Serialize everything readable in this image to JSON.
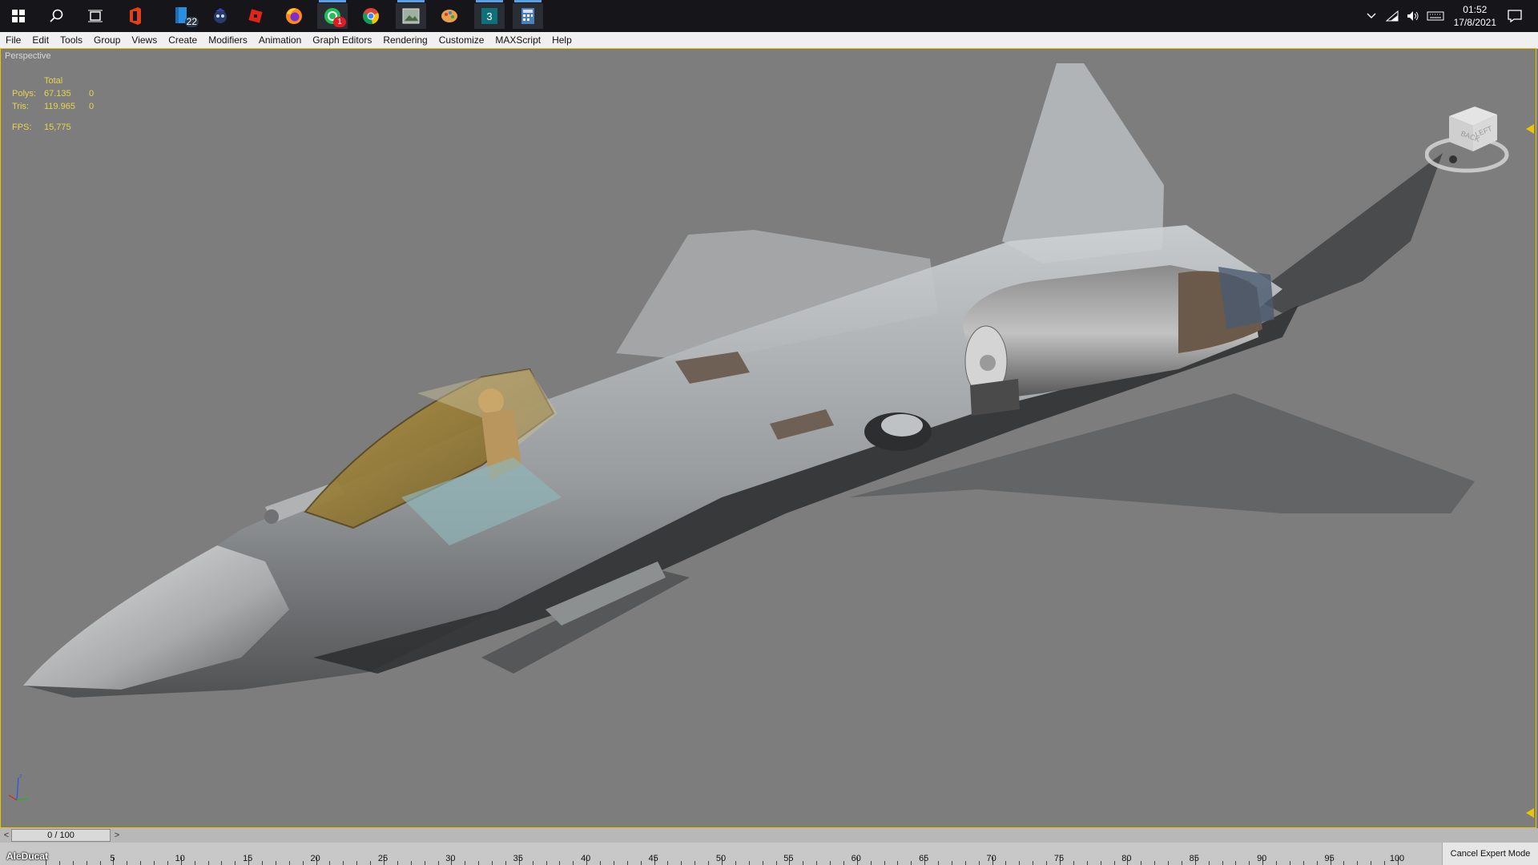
{
  "taskbar": {
    "icons": [
      {
        "name": "windows-start-icon",
        "badge": ""
      },
      {
        "name": "search-icon",
        "badge": ""
      },
      {
        "name": "task-view-icon",
        "badge": ""
      },
      {
        "name": "office-icon",
        "badge": ""
      },
      {
        "name": "file-explorer-icon",
        "badge": "22"
      },
      {
        "name": "game-app-icon",
        "badge": ""
      },
      {
        "name": "roblox-icon",
        "badge": ""
      },
      {
        "name": "firefox-icon",
        "badge": ""
      },
      {
        "name": "whatsapp-icon",
        "badge": "1"
      },
      {
        "name": "chrome-icon",
        "badge": ""
      },
      {
        "name": "image-viewer-icon",
        "badge": ""
      },
      {
        "name": "paint-app-icon",
        "badge": ""
      },
      {
        "name": "3ds-max-icon",
        "badge": ""
      },
      {
        "name": "calculator-icon",
        "badge": ""
      }
    ],
    "clock_time": "01:52",
    "clock_date": "17/8/2021"
  },
  "menu": [
    "File",
    "Edit",
    "Tools",
    "Group",
    "Views",
    "Create",
    "Modifiers",
    "Animation",
    "Graph Editors",
    "Rendering",
    "Customize",
    "MAXScript",
    "Help"
  ],
  "viewport": {
    "label": "Perspective",
    "stats_header": "Total",
    "polys_label": "Polys:",
    "polys_total": "67.135",
    "polys_sel": "0",
    "tris_label": "Tris:",
    "tris_total": "119.965",
    "tris_sel": "0",
    "fps_label": "FPS:",
    "fps_value": "15,775"
  },
  "viewcube": {
    "face_back": "BACK",
    "face_left": "LEFT"
  },
  "timeslider": {
    "value": "0 / 100",
    "prev": "<",
    "next": ">"
  },
  "trackbar": {
    "labels": [
      "5",
      "10",
      "15",
      "20",
      "25",
      "30",
      "35",
      "40",
      "45",
      "50",
      "55",
      "60",
      "65",
      "70",
      "75",
      "80",
      "85",
      "90",
      "95",
      "100"
    ]
  },
  "status": {
    "expert_mode": "Cancel Expert Mode"
  },
  "watermark": "AleDucat",
  "colors": {
    "viewport_bg": "#7d7d7d",
    "viewport_border": "#e9c400",
    "stats_text": "#e8d44d"
  }
}
